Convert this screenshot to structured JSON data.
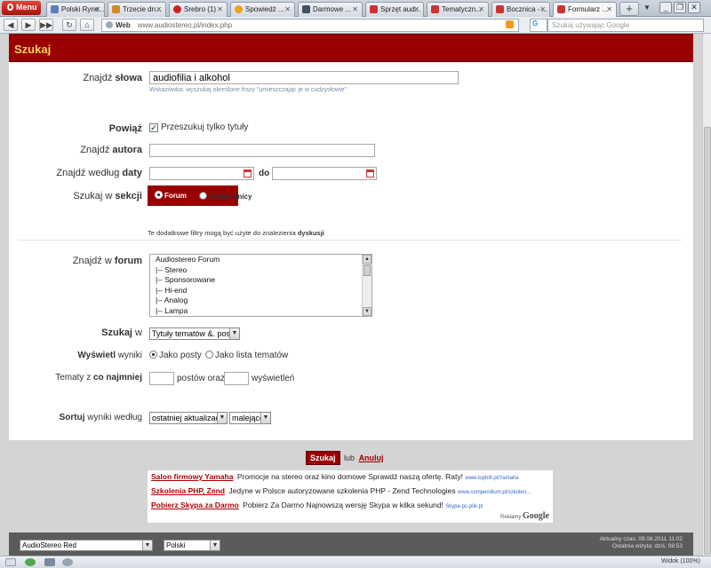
{
  "browser": {
    "menu_label": "Menu",
    "tabs": [
      {
        "label": "Polski Ryne...",
        "color": "#5b7fb9",
        "active": false
      },
      {
        "label": "Trzecie dn...",
        "color": "#d28a26",
        "active": false
      },
      {
        "label": "Srebro (1)",
        "color": "#cc2222",
        "active": false
      },
      {
        "label": "Spowiedź ...",
        "color": "#f0a020",
        "active": false
      },
      {
        "label": "Darmowe ...",
        "color": "#44505f",
        "active": false
      },
      {
        "label": "Sprzęt aud...",
        "color": "#cc3333",
        "active": false
      },
      {
        "label": "Tematyczn...",
        "color": "#cc3333",
        "active": false
      },
      {
        "label": "Bocznica - ...",
        "color": "#cc3333",
        "active": false
      },
      {
        "label": "Formularz ...",
        "color": "#cc3333",
        "active": true
      }
    ],
    "address_label": "Web",
    "url": "www.audiostereo.pl/index.php",
    "search_engine": "G",
    "search_placeholder": "Szukaj używając Google",
    "zoom": "Widok (100%)"
  },
  "page": {
    "title": "Szukaj",
    "keywords": {
      "label_plain": "Znajdź ",
      "label_bold": "słowa",
      "value": "audiofilia i alkohol",
      "hint": "Wskazówka: wyszukaj określone frazy \"umieszczając je w cudzysłowie\""
    },
    "link": {
      "label": "Powiąż",
      "checkbox_label": "Przeszukuj tylko tytuły",
      "checked": true
    },
    "author": {
      "label_plain": "Znajdź ",
      "label_bold": "autora",
      "value": ""
    },
    "date": {
      "label_plain": "Znajdź według ",
      "label_bold": "daty",
      "to_label": "do",
      "from": "",
      "to": ""
    },
    "section": {
      "label_plain": "Szukaj w ",
      "label_bold": "sekcji",
      "options": [
        "Forum",
        "Użytkownicy"
      ],
      "selected": "Forum"
    },
    "filters_note_plain": "Te dodatkowe filtry mogą być użyte do znalezienia ",
    "filters_note_bold": "dyskusji",
    "forum": {
      "label_plain": "Znajdź w ",
      "label_bold": "forum",
      "options": [
        "Audiostereo Forum",
        "|-- Stereo",
        "|-- Sponsorowane",
        "|-- Hi-end",
        "|-- Analog",
        "|-- Lampa"
      ]
    },
    "search_in": {
      "label_bold": "Szukaj",
      "label_plain": " w",
      "value": "Tytuły tematów &. posty"
    },
    "show_results": {
      "label_bold": "Wyświetl",
      "label_plain": " wyniki",
      "options": [
        "Jako posty",
        "Jako lista tematów"
      ],
      "selected": "Jako posty"
    },
    "min_topics": {
      "label_plain": "Tematy z ",
      "label_bold": "co najmniej",
      "posts_label": "postów oraz",
      "views_label": "wyświetleń",
      "posts_value": "",
      "views_value": ""
    },
    "sort": {
      "label_bold": "Sortuj",
      "label_plain": " wyniki według",
      "field": "ostatniej aktualizacji",
      "order": "malejąco"
    },
    "submit_label": "Szukaj",
    "or_label": "lub",
    "cancel_label": "Anuluj"
  },
  "ads": {
    "items": [
      {
        "title": "Salon firmowy Yamaha",
        "text": "Promocje na stereo oraz kino domowe Sprawdź naszą ofertę. Raty!",
        "url": "www.tophifi.pl/Yamaha"
      },
      {
        "title": "Szkolenia PHP, Zend",
        "text": "Jedyne w Polsce autoryzowane szkolenia PHP - Zend Technologies",
        "url": "www.compendium.pl/szkolen..."
      },
      {
        "title": "Pobierz Skypa za Darmo",
        "text": "Pobierz Za Darmo Najnowszą wersję Skypa w kilka sekund!",
        "url": "Skype.pc-plik.pl"
      }
    ],
    "label": "Reklamy",
    "brand": "Google"
  },
  "footer": {
    "style_select": "AudioStereo Red",
    "language_select": "Polski",
    "current_time": "Aktualny czas: 09.06.2011 11:02",
    "last_visit": "Ostatnia wizyta: dziś, 08:53"
  }
}
